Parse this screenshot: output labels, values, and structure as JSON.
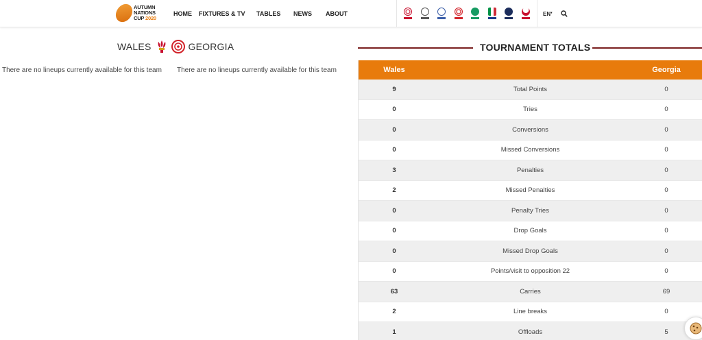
{
  "header": {
    "logo": {
      "line1": "AUTUMN",
      "line2": "NATIONS",
      "line3": "CUP",
      "year": "2020"
    },
    "nav": [
      {
        "label": "HOME"
      },
      {
        "label": "FIXTURES & TV"
      },
      {
        "label": "TABLES"
      },
      {
        "label": "NEWS"
      },
      {
        "label": "ABOUT"
      }
    ],
    "flags": [
      "england-crest-icon",
      "scotland-thistle-icon",
      "fiji-crest-icon",
      "georgia-crest-icon",
      "ireland-shamrock-icon",
      "italy-crest-icon",
      "scotland-rugby-icon",
      "wales-feathers-icon"
    ],
    "language": "EN",
    "search_icon": "search-icon"
  },
  "match": {
    "home": "WALES",
    "away": "GEORGIA",
    "home_lineup_msg": "There are no lineups currently available for this team",
    "away_lineup_msg": "There are no lineups currently available for this team"
  },
  "totals": {
    "title": "TOURNAMENT TOTALS",
    "home_label": "Wales",
    "away_label": "Georgia",
    "rows": [
      {
        "home": "9",
        "stat": "Total Points",
        "away": "0"
      },
      {
        "home": "0",
        "stat": "Tries",
        "away": "0"
      },
      {
        "home": "0",
        "stat": "Conversions",
        "away": "0"
      },
      {
        "home": "0",
        "stat": "Missed Conversions",
        "away": "0"
      },
      {
        "home": "3",
        "stat": "Penalties",
        "away": "0"
      },
      {
        "home": "2",
        "stat": "Missed Penalties",
        "away": "0"
      },
      {
        "home": "0",
        "stat": "Penalty Tries",
        "away": "0"
      },
      {
        "home": "0",
        "stat": "Drop Goals",
        "away": "0"
      },
      {
        "home": "0",
        "stat": "Missed Drop Goals",
        "away": "0"
      },
      {
        "home": "0",
        "stat": "Points/visit to opposition 22",
        "away": "0"
      },
      {
        "home": "63",
        "stat": "Carries",
        "away": "69"
      },
      {
        "home": "2",
        "stat": "Line breaks",
        "away": "0"
      },
      {
        "home": "1",
        "stat": "Offloads",
        "away": "5"
      }
    ]
  },
  "colors": {
    "accent": "#e87b0c",
    "rule": "#7a1f1f"
  }
}
